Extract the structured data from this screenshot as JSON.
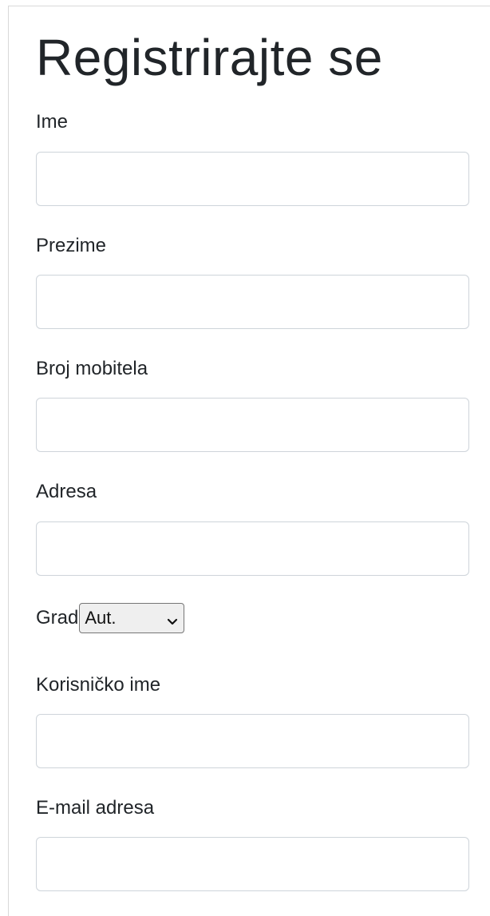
{
  "form": {
    "title": "Registrirajte se",
    "fields": [
      {
        "label": "Ime",
        "value": ""
      },
      {
        "label": "Prezime",
        "value": ""
      },
      {
        "label": "Broj mobitela",
        "value": ""
      },
      {
        "label": "Adresa",
        "value": ""
      },
      {
        "label": "Korisničko ime",
        "value": ""
      },
      {
        "label": "E-mail adresa",
        "value": ""
      }
    ],
    "city": {
      "label": "Grad",
      "selected": "Aut."
    }
  },
  "icons": {
    "select_arrow": "chevron-down-icon"
  }
}
